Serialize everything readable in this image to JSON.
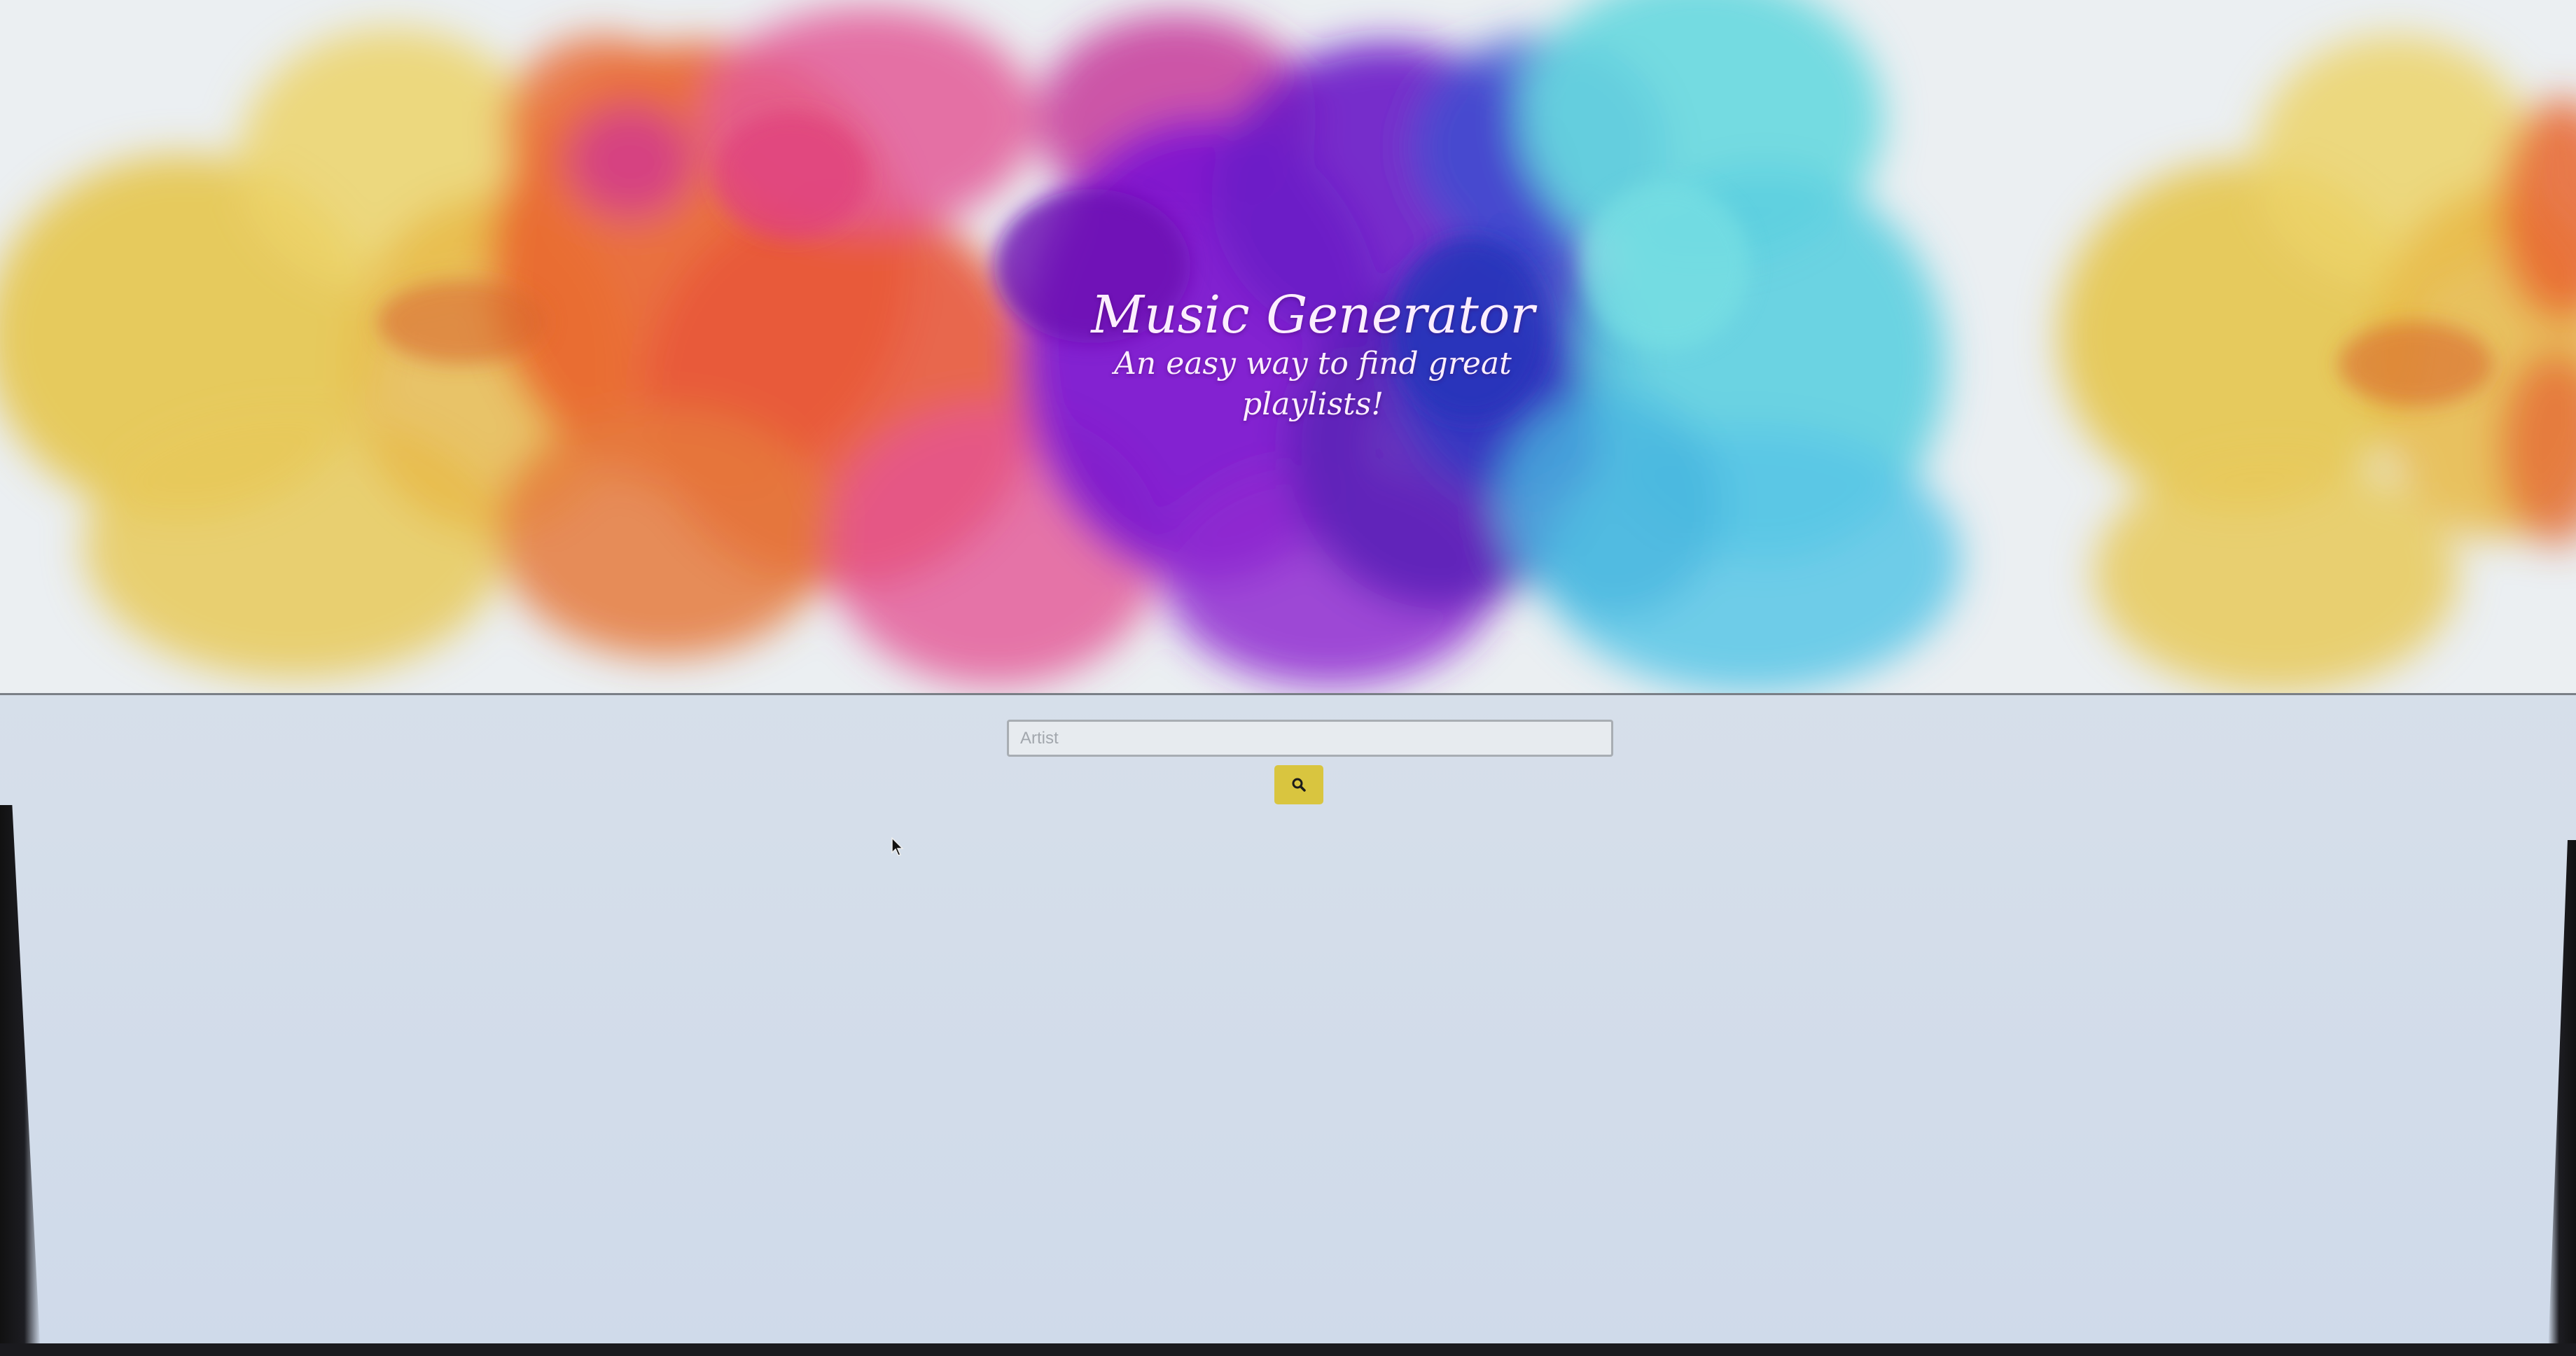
{
  "banner": {
    "title": "Music Generator",
    "subtitle": "An easy way to find great playlists!"
  },
  "search": {
    "placeholder": "Artist",
    "value": "",
    "button_icon": "search-icon",
    "button_color": "#d9c53f"
  },
  "colors": {
    "background": "#d8e0ea",
    "title_text": "#fbeefd",
    "paint_yellow": "#e3c24a",
    "paint_orange": "#e8652f",
    "paint_pink": "#dc4fa8",
    "paint_purple": "#7a1fd1",
    "paint_blue": "#2d3fc2",
    "paint_cyan": "#5fd6e0"
  }
}
